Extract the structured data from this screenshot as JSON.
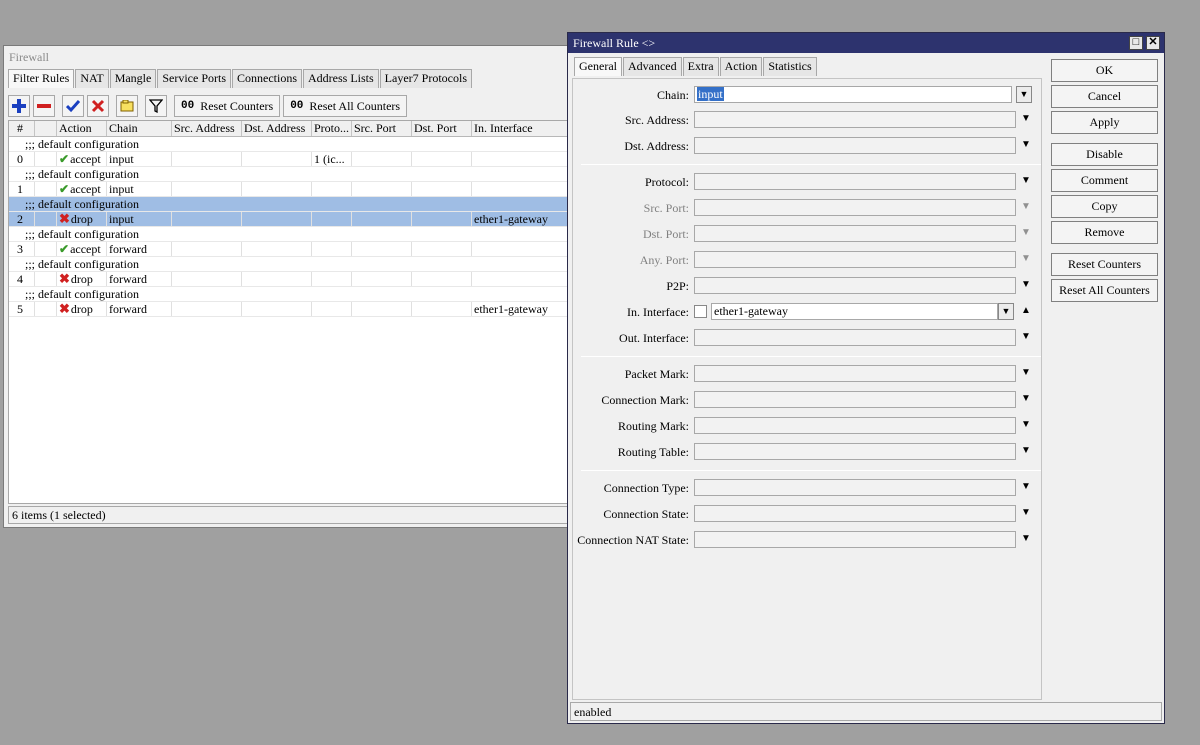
{
  "firewall": {
    "title": "Firewall",
    "tabs": [
      "Filter Rules",
      "NAT",
      "Mangle",
      "Service Ports",
      "Connections",
      "Address Lists",
      "Layer7 Protocols"
    ],
    "toolbar": {
      "reset_counters": "Reset Counters",
      "reset_all_counters": "Reset All Counters",
      "oo": "00"
    },
    "columns": [
      "#",
      "",
      "Action",
      "Chain",
      "Src. Address",
      "Dst. Address",
      "Proto...",
      "Src. Port",
      "Dst. Port",
      "In. Interface"
    ],
    "comment": ";;; default configuration",
    "rules": [
      {
        "num": "0",
        "action": "accept",
        "chain": "input",
        "proto": "1 (ic...",
        "in_if": "",
        "kind": "accept"
      },
      {
        "num": "1",
        "action": "accept",
        "chain": "input",
        "proto": "",
        "in_if": "",
        "kind": "accept"
      },
      {
        "num": "2",
        "action": "drop",
        "chain": "input",
        "proto": "",
        "in_if": "ether1-gateway",
        "kind": "drop"
      },
      {
        "num": "3",
        "action": "accept",
        "chain": "forward",
        "proto": "",
        "in_if": "",
        "kind": "accept"
      },
      {
        "num": "4",
        "action": "drop",
        "chain": "forward",
        "proto": "",
        "in_if": "",
        "kind": "drop"
      },
      {
        "num": "5",
        "action": "drop",
        "chain": "forward",
        "proto": "",
        "in_if": "ether1-gateway",
        "kind": "drop"
      }
    ],
    "status": "6 items (1 selected)"
  },
  "rule": {
    "title": "Firewall Rule <>",
    "tabs": [
      "General",
      "Advanced",
      "Extra",
      "Action",
      "Statistics"
    ],
    "labels": {
      "chain": "Chain:",
      "src_address": "Src. Address:",
      "dst_address": "Dst. Address:",
      "protocol": "Protocol:",
      "src_port": "Src. Port:",
      "dst_port": "Dst. Port:",
      "any_port": "Any. Port:",
      "p2p": "P2P:",
      "in_interface": "In. Interface:",
      "out_interface": "Out. Interface:",
      "packet_mark": "Packet Mark:",
      "connection_mark": "Connection Mark:",
      "routing_mark": "Routing Mark:",
      "routing_table": "Routing Table:",
      "connection_type": "Connection Type:",
      "connection_state": "Connection State:",
      "connection_nat_state": "Connection NAT State:"
    },
    "values": {
      "chain": "input",
      "in_interface": "ether1-gateway"
    },
    "buttons": {
      "ok": "OK",
      "cancel": "Cancel",
      "apply": "Apply",
      "disable": "Disable",
      "comment": "Comment",
      "copy": "Copy",
      "remove": "Remove",
      "reset_counters": "Reset Counters",
      "reset_all_counters": "Reset All Counters"
    },
    "status": "enabled"
  },
  "colors": {
    "title_bar": "#2d336e",
    "selected_row": "#9fbde4",
    "accept": "#3a9a2a",
    "drop": "#d02020"
  }
}
